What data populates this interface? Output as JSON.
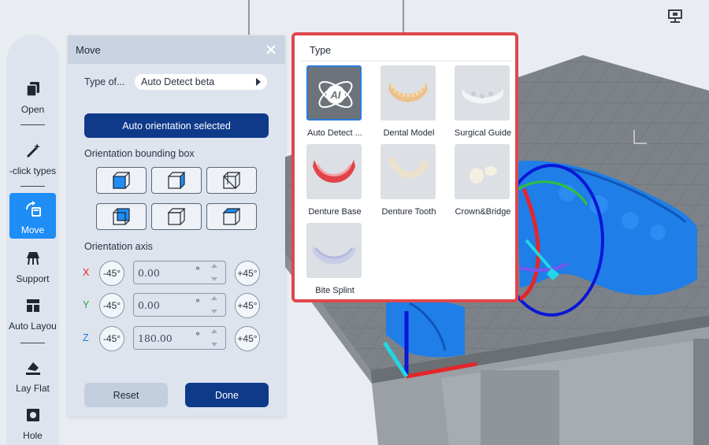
{
  "toolbar": {
    "items": [
      {
        "label": "Open",
        "icon": "file-copy-icon"
      },
      {
        "label": "-click types",
        "icon": "magic-wand-icon"
      },
      {
        "label": "Move",
        "icon": "move-icon"
      },
      {
        "label": "Support",
        "icon": "support-icon"
      },
      {
        "label": "Auto Layou",
        "icon": "layout-icon"
      },
      {
        "label": "Lay Flat",
        "icon": "lay-flat-icon"
      },
      {
        "label": "Hole",
        "icon": "hole-icon"
      }
    ],
    "active": "Move"
  },
  "move_panel": {
    "title": "Move",
    "type_label": "Type of...",
    "type_value": "Auto Detect beta",
    "auto_button": "Auto orientation selected",
    "bbox_label": "Orientation bounding box",
    "axis_label": "Orientation axis",
    "axes": [
      {
        "letter": "X",
        "minus": "-45°",
        "value": "0.00",
        "unit": "°",
        "plus": "+45°"
      },
      {
        "letter": "Y",
        "minus": "-45°",
        "value": "0.00",
        "unit": "°",
        "plus": "+45°"
      },
      {
        "letter": "Z",
        "minus": "-45°",
        "value": "180.00",
        "unit": "°",
        "plus": "+45°"
      }
    ],
    "reset_label": "Reset",
    "done_label": "Done"
  },
  "type_popup": {
    "title": "Type",
    "items": [
      {
        "label": "Auto Detect ...",
        "selected": true
      },
      {
        "label": "Dental Model",
        "selected": false
      },
      {
        "label": "Surgical Guide",
        "selected": false
      },
      {
        "label": "Denture Base",
        "selected": false
      },
      {
        "label": "Denture Tooth",
        "selected": false
      },
      {
        "label": "Crown&Bridge",
        "selected": false
      },
      {
        "label": "Bite Splint",
        "selected": false
      }
    ],
    "ai_badge": "AI"
  },
  "colors": {
    "accent": "#1e8df5",
    "primary_button": "#0f3a8a",
    "popup_border": "#e0474c",
    "axis_x": "#e3262b",
    "axis_y": "#2fa33a",
    "axis_z": "#1f7be0",
    "model": "#1f7ee8"
  }
}
